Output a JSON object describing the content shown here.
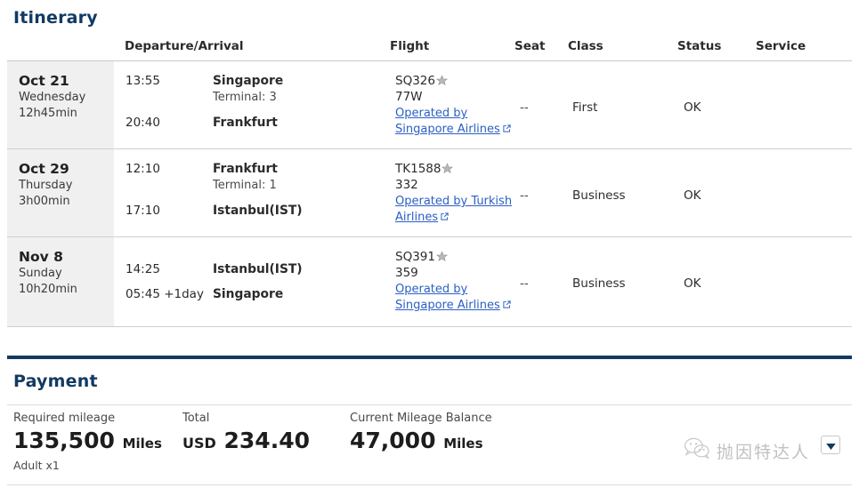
{
  "itinerary": {
    "title": "Itinerary",
    "columns": {
      "departure_arrival": "Departure/Arrival",
      "flight": "Flight",
      "seat": "Seat",
      "class": "Class",
      "status": "Status",
      "service": "Service"
    },
    "rows": [
      {
        "date": "Oct 21",
        "weekday": "Wednesday",
        "duration": "12h45min",
        "depart_time": "13:55",
        "depart_place": "Singapore",
        "depart_terminal": "Terminal: 3",
        "arrive_time": "20:40",
        "arrive_place": "Frankfurt",
        "flight_number": "SQ326",
        "equipment": "77W",
        "operated_by": "Operated by Singapore Airlines",
        "seat": "--",
        "class": "First",
        "status": "OK",
        "service": ""
      },
      {
        "date": "Oct 29",
        "weekday": "Thursday",
        "duration": "3h00min",
        "depart_time": "12:10",
        "depart_place": "Frankfurt",
        "depart_terminal": "Terminal: 1",
        "arrive_time": "17:10",
        "arrive_place": "Istanbul(IST)",
        "flight_number": "TK1588",
        "equipment": "332",
        "operated_by": "Operated by Turkish Airlines",
        "seat": "--",
        "class": "Business",
        "status": "OK",
        "service": ""
      },
      {
        "date": "Nov 8",
        "weekday": "Sunday",
        "duration": "10h20min",
        "depart_time": "14:25",
        "depart_place": "Istanbul(IST)",
        "depart_terminal": "",
        "arrive_time": "05:45 +1day",
        "arrive_place": "Singapore",
        "flight_number": "SQ391",
        "equipment": "359",
        "operated_by": "Operated by Singapore Airlines",
        "seat": "--",
        "class": "Business",
        "status": "OK",
        "service": ""
      }
    ]
  },
  "payment": {
    "title": "Payment",
    "required": {
      "label": "Required mileage",
      "value": "135,500",
      "unit": "Miles",
      "sub": "Adult x1"
    },
    "total": {
      "label": "Total",
      "currency": "USD",
      "value": "234.40"
    },
    "balance": {
      "label": "Current Mileage Balance",
      "value": "47,000",
      "unit": "Miles"
    }
  },
  "watermark": {
    "text": "抛因特达人"
  },
  "colors": {
    "heading_navy": "#123a63",
    "link_blue": "#2b5fc4",
    "row_day_bg": "#f0f0f0",
    "divider": "#cfcfcf"
  }
}
